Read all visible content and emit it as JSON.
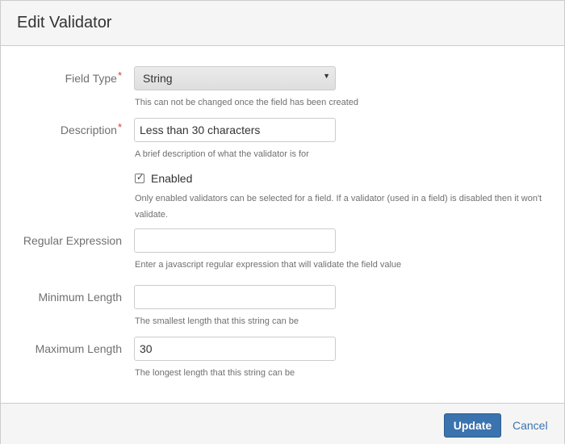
{
  "dialog": {
    "title": "Edit Validator"
  },
  "form": {
    "field_type": {
      "label": "Field Type",
      "required_mark": "*",
      "selected": "String",
      "help": "This can not be changed once the field has been created"
    },
    "description": {
      "label": "Description",
      "required_mark": "*",
      "value": "Less than 30 characters",
      "help": "A brief description of what the validator is for"
    },
    "enabled": {
      "label": "Enabled",
      "checked": true,
      "check_glyph": "✓",
      "help": "Only enabled validators can be selected for a field. If a validator (used in a field) is disabled then it won't validate."
    },
    "regex": {
      "label": "Regular Expression",
      "value": "",
      "help": "Enter a javascript regular expression that will validate the field value"
    },
    "min_length": {
      "label": "Minimum Length",
      "value": "",
      "help": "The smallest length that this string can be"
    },
    "max_length": {
      "label": "Maximum Length",
      "value": "30",
      "help": "The longest length that this string can be"
    }
  },
  "footer": {
    "update_label": "Update",
    "cancel_label": "Cancel"
  },
  "colors": {
    "primary": "#3b73af",
    "required": "#d04437"
  }
}
